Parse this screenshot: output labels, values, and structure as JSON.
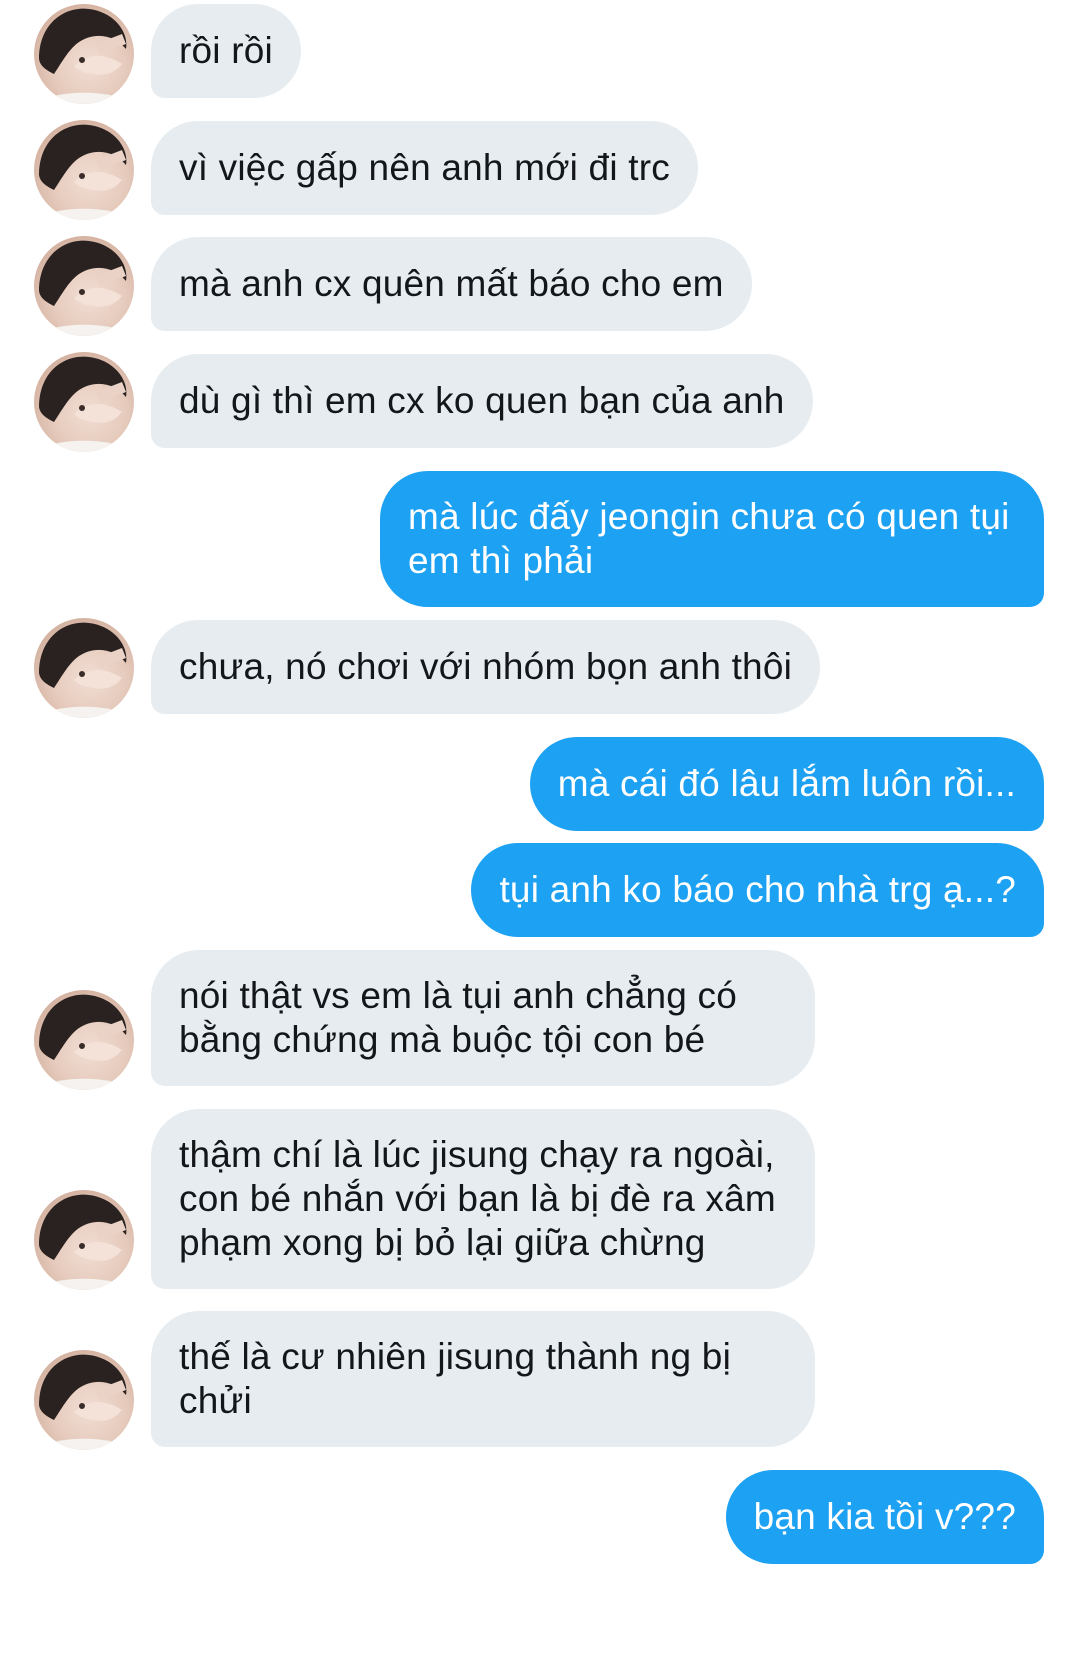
{
  "conversation": {
    "messages": [
      {
        "sender": "other",
        "text": "rồi rồi"
      },
      {
        "sender": "other",
        "text": "vì việc gấp nên anh mới đi trc"
      },
      {
        "sender": "other",
        "text": "mà anh cx quên mất báo cho em"
      },
      {
        "sender": "other",
        "text": "dù gì thì em cx ko quen bạn của anh"
      },
      {
        "sender": "me",
        "text": "mà lúc đấy jeongin chưa có quen tụi em thì phải"
      },
      {
        "sender": "other",
        "text": "chưa, nó chơi với nhóm bọn anh thôi"
      },
      {
        "sender": "me",
        "text": "mà cái đó lâu lắm luôn rồi..."
      },
      {
        "sender": "me",
        "text": "tụi anh ko báo cho nhà trg ạ...?"
      },
      {
        "sender": "other",
        "text": "nói thật vs em là tụi anh chẳng có bằng chứng mà buộc tội con bé"
      },
      {
        "sender": "other",
        "text": "thậm chí là lúc jisung chạy ra ngoài, con bé nhắn với bạn là bị đè ra xâm phạm xong bị bỏ lại giữa chừng"
      },
      {
        "sender": "other",
        "text": "thế là cư nhiên jisung thành ng bị chửi"
      },
      {
        "sender": "me",
        "text": "bạn kia tồi v???"
      }
    ]
  },
  "colors": {
    "incoming_bubble": "#e6ecf0",
    "incoming_text": "#14171a",
    "outgoing_bubble": "#1da1f2",
    "outgoing_text": "#ffffff"
  },
  "icons": {
    "avatar": "user-avatar-icon"
  }
}
